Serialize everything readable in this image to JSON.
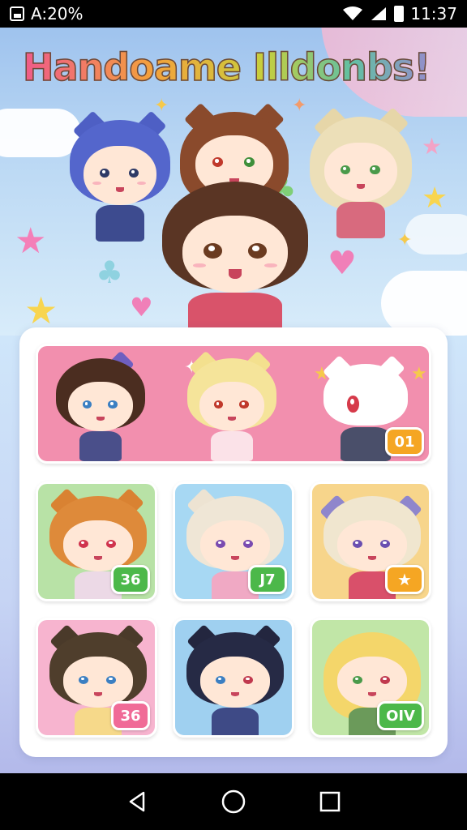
{
  "status_bar": {
    "left_text": "A:20%",
    "time": "11:37",
    "icons": [
      "app-notification-icon",
      "wifi-icon",
      "signal-icon",
      "battery-icon"
    ]
  },
  "header": {
    "title": "Handoame Illdonbs!"
  },
  "gallery": {
    "featured": {
      "badge": "01",
      "badge_color": "#f5a623",
      "bg_color": "#f28fae"
    },
    "tiles": [
      {
        "badge": "36",
        "badge_color": "#4cb84a",
        "bg_color": "#b8e2a6"
      },
      {
        "badge": "J7",
        "badge_color": "#4cb84a",
        "bg_color": "#a7d8f3"
      },
      {
        "badge": "",
        "badge_icon": "star-badge-icon",
        "badge_color": "#f5a623",
        "bg_color": "#f7d58b"
      },
      {
        "badge": "36",
        "badge_color": "#f06b97",
        "bg_color": "#f7b4cf"
      },
      {
        "badge": "",
        "badge_color": "#4cb84a",
        "bg_color": "#9fd0f0"
      },
      {
        "badge": "OIV",
        "badge_color": "#4cb84a",
        "bg_color": "#c1e6a7"
      }
    ]
  },
  "nav_bar": {
    "buttons": [
      "back-icon",
      "home-icon",
      "recents-icon"
    ]
  },
  "colors": {
    "status_bar_bg": "#000000",
    "panel_bg": "#ffffff",
    "accent_pink": "#f28fae"
  }
}
